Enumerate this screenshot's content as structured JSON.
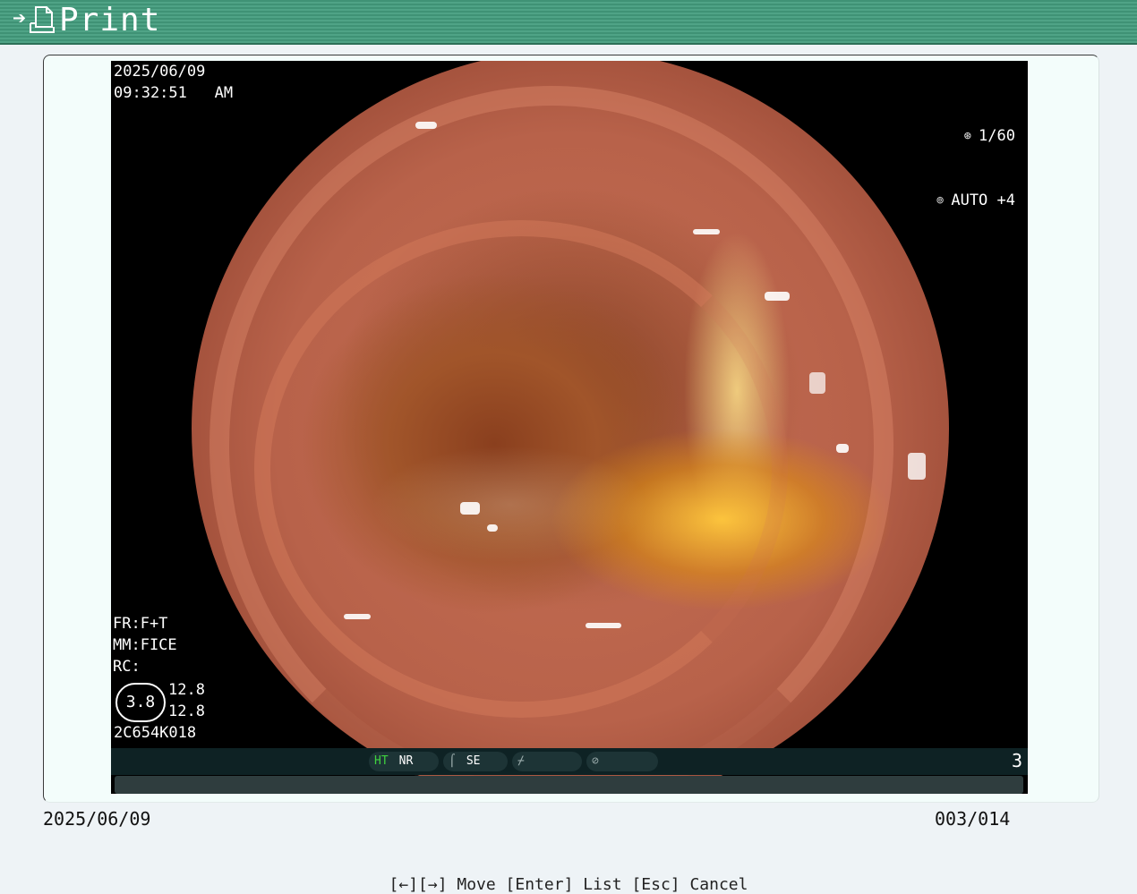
{
  "header": {
    "title": "Print",
    "nav_icon": "right-arrow-icon",
    "doc_icon": "document-icon"
  },
  "image": {
    "date": "2025/06/09",
    "time": "09:32:51",
    "ampm": "AM",
    "shutter": "1/60",
    "iris": "AUTO +4",
    "fr": "FR:F+T",
    "mm": "MM:FICE",
    "rc": "RC:",
    "circle_value": "3.8",
    "value1": "12.8",
    "value2": "12.8",
    "code": "2C654K018"
  },
  "status": {
    "ht": "HT",
    "nr": "NR",
    "se": "SE",
    "number": "3"
  },
  "footer": {
    "date": "2025/06/09",
    "count": "003/014",
    "hint": "[←][→] Move  [Enter] List  [Esc] Cancel"
  },
  "colors": {
    "header_green": "#3f9275",
    "ht_green": "#3fd23f",
    "background": "#eef3f6"
  }
}
